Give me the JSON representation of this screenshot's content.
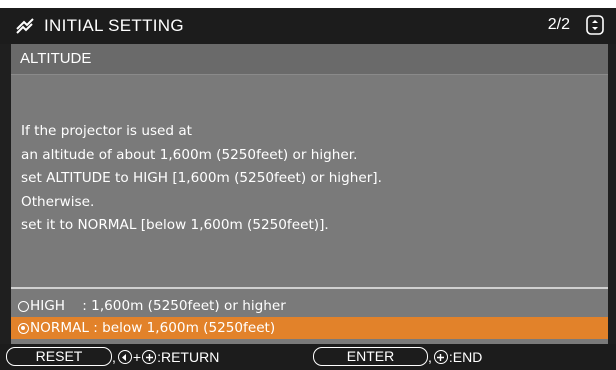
{
  "header": {
    "title": "INITIAL SETTING",
    "page": "2/2",
    "icons": [
      "setting-icon",
      "scroll-icon"
    ]
  },
  "panel": {
    "title": "ALTITUDE",
    "lines": [
      "If the projector is used at",
      "an altitude of about 1,600m (5250feet) or higher.",
      "set ALTITUDE to HIGH [1,600m (5250feet) or higher].",
      "Otherwise.",
      "set it to NORMAL [below 1,600m (5250feet)]."
    ]
  },
  "options": [
    {
      "label": "HIGH    : 1,600m (5250feet) or higher",
      "selected": false
    },
    {
      "label": "NORMAL : below 1,600m (5250feet)",
      "selected": true
    }
  ],
  "footer": {
    "reset_key": "RESET",
    "return_hint": ":RETURN",
    "enter_key": "ENTER",
    "end_hint": ":END"
  },
  "colors": {
    "highlight": "#e2822a",
    "panel": "#7a7a7a",
    "bar": "#1c1c1c"
  }
}
